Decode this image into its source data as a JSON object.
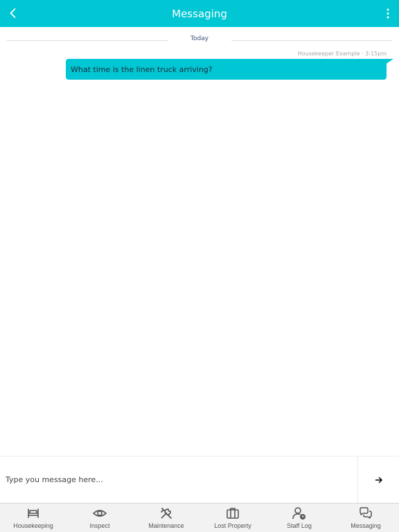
{
  "header": {
    "title": "Messaging",
    "back_icon": "chevron-left-icon",
    "menu_icon": "more-vertical-icon"
  },
  "thread": {
    "date_divider": "Today",
    "messages": [
      {
        "meta": "Housekeeper Example · 3:15pm",
        "text": "What time is the linen truck arriving?"
      }
    ]
  },
  "composer": {
    "placeholder": "Type you message here...",
    "value": "",
    "send_icon": "arrow-right-icon"
  },
  "tabs": [
    {
      "label": "Housekeeping",
      "icon": "bed-icon"
    },
    {
      "label": "Inspect",
      "icon": "eye-icon"
    },
    {
      "label": "Maintenance",
      "icon": "tools-icon"
    },
    {
      "label": "Lost Property",
      "icon": "briefcase-icon"
    },
    {
      "label": "Staff Log",
      "icon": "user-clock-icon"
    },
    {
      "label": "Messaging",
      "icon": "chat-bubbles-icon"
    }
  ],
  "colors": {
    "accent": "#00c7d3",
    "tabbar_bg": "#f2f2f2",
    "icon_gray": "#555555"
  }
}
